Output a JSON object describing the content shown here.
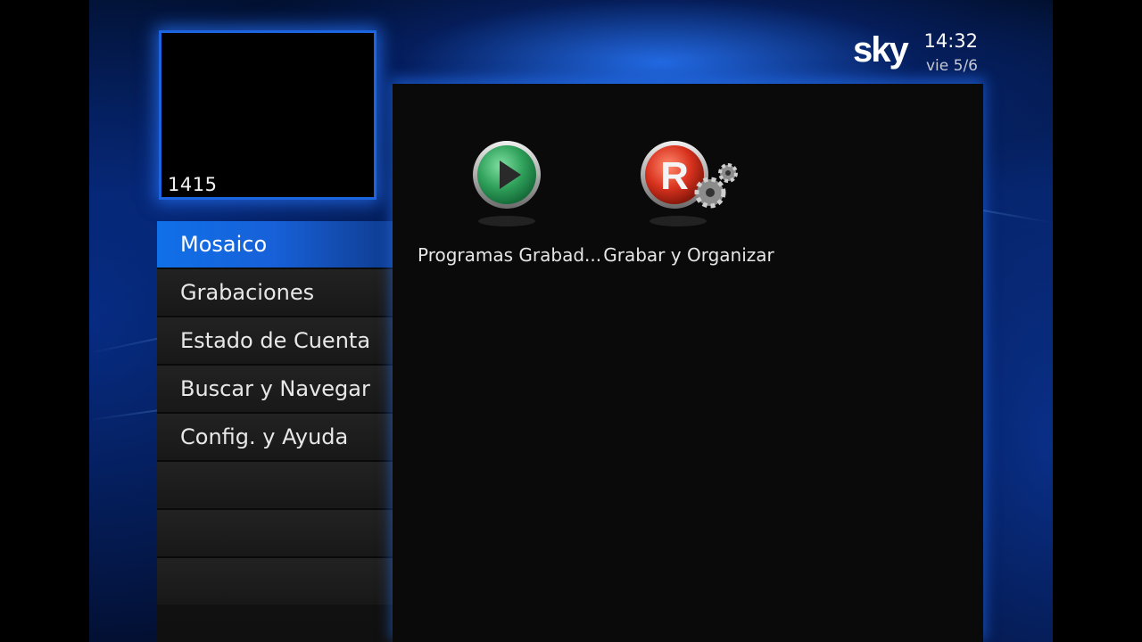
{
  "preview": {
    "channel": "1415"
  },
  "brand": {
    "logo_text": "sky",
    "time": "14:32",
    "date": "vie 5/6"
  },
  "menu": {
    "items": [
      {
        "label": "Mosaico",
        "selected": true
      },
      {
        "label": "Grabaciones"
      },
      {
        "label": "Estado de Cuenta"
      },
      {
        "label": "Buscar y Navegar"
      },
      {
        "label": "Config. y Ayuda"
      },
      {
        "label": ""
      },
      {
        "label": ""
      },
      {
        "label": ""
      }
    ]
  },
  "content": {
    "tiles": [
      {
        "label": "Programas Grabad...",
        "icon": "play-icon",
        "color": "#2fa05a"
      },
      {
        "label": "Grabar y Organizar",
        "icon": "record-settings-icon",
        "color": "#d8321e"
      }
    ]
  },
  "colors": {
    "accent": "#1d64e0",
    "selected": "#1070e8"
  }
}
